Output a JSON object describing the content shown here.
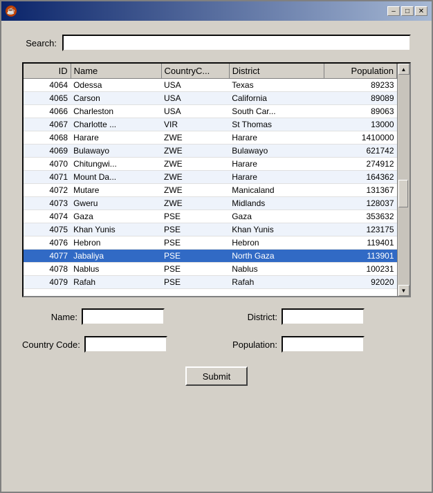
{
  "window": {
    "title": "",
    "minimize_label": "–",
    "maximize_label": "□",
    "close_label": "✕"
  },
  "search": {
    "label": "Search:",
    "placeholder": "",
    "value": ""
  },
  "table": {
    "columns": [
      {
        "key": "id",
        "label": "ID"
      },
      {
        "key": "name",
        "label": "Name"
      },
      {
        "key": "country",
        "label": "CountryC..."
      },
      {
        "key": "district",
        "label": "District"
      },
      {
        "key": "population",
        "label": "Population"
      }
    ],
    "rows": [
      {
        "id": "4064",
        "name": "Odessa",
        "country": "USA",
        "district": "Texas",
        "population": "89233"
      },
      {
        "id": "4065",
        "name": "Carson",
        "country": "USA",
        "district": "California",
        "population": "89089"
      },
      {
        "id": "4066",
        "name": "Charleston",
        "country": "USA",
        "district": "South Car...",
        "population": "89063"
      },
      {
        "id": "4067",
        "name": "Charlotte ...",
        "country": "VIR",
        "district": "St Thomas",
        "population": "13000"
      },
      {
        "id": "4068",
        "name": "Harare",
        "country": "ZWE",
        "district": "Harare",
        "population": "1410000"
      },
      {
        "id": "4069",
        "name": "Bulawayo",
        "country": "ZWE",
        "district": "Bulawayo",
        "population": "621742"
      },
      {
        "id": "4070",
        "name": "Chitungwi...",
        "country": "ZWE",
        "district": "Harare",
        "population": "274912"
      },
      {
        "id": "4071",
        "name": "Mount Da...",
        "country": "ZWE",
        "district": "Harare",
        "population": "164362"
      },
      {
        "id": "4072",
        "name": "Mutare",
        "country": "ZWE",
        "district": "Manicaland",
        "population": "131367"
      },
      {
        "id": "4073",
        "name": "Gweru",
        "country": "ZWE",
        "district": "Midlands",
        "population": "128037"
      },
      {
        "id": "4074",
        "name": "Gaza",
        "country": "PSE",
        "district": "Gaza",
        "population": "353632"
      },
      {
        "id": "4075",
        "name": "Khan Yunis",
        "country": "PSE",
        "district": "Khan Yunis",
        "population": "123175"
      },
      {
        "id": "4076",
        "name": "Hebron",
        "country": "PSE",
        "district": "Hebron",
        "population": "119401"
      },
      {
        "id": "4077",
        "name": "Jabaliya",
        "country": "PSE",
        "district": "North Gaza",
        "population": "113901"
      },
      {
        "id": "4078",
        "name": "Nablus",
        "country": "PSE",
        "district": "Nablus",
        "population": "100231"
      },
      {
        "id": "4079",
        "name": "Rafah",
        "country": "PSE",
        "district": "Rafah",
        "population": "92020"
      }
    ]
  },
  "form": {
    "name_label": "Name:",
    "district_label": "District:",
    "country_code_label": "Country Code:",
    "population_label": "Population:",
    "submit_label": "Submit"
  }
}
